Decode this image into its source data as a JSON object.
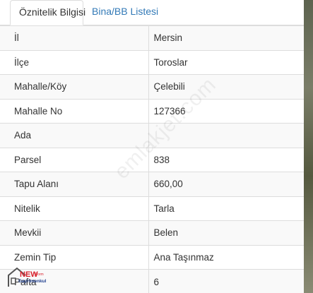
{
  "tabs": [
    {
      "label": "Öznitelik Bilgisi",
      "active": true
    },
    {
      "label": "Bina/BB Listesi",
      "active": false
    }
  ],
  "rows": [
    {
      "key": "İl",
      "value": "Mersin"
    },
    {
      "key": "İlçe",
      "value": "Toroslar"
    },
    {
      "key": "Mahalle/Köy",
      "value": "Çelebili"
    },
    {
      "key": "Mahalle No",
      "value": "127366"
    },
    {
      "key": "Ada",
      "value": ""
    },
    {
      "key": "Parsel",
      "value": "838"
    },
    {
      "key": "Tapu Alanı",
      "value": "660,00"
    },
    {
      "key": "Nitelik",
      "value": "Tarla"
    },
    {
      "key": "Mevkii",
      "value": "Belen"
    },
    {
      "key": "Zemin Tip",
      "value": "Ana Taşınmaz"
    },
    {
      "key": "Pafta",
      "value": "6"
    }
  ],
  "watermark": "emlakjet.com",
  "logo": {
    "text": "NEW Form Gayrimenkul"
  },
  "colors": {
    "accent": "#337ab7",
    "border": "#dddddd",
    "stripe": "#f9f9f9",
    "logo_red": "#d9232e"
  }
}
